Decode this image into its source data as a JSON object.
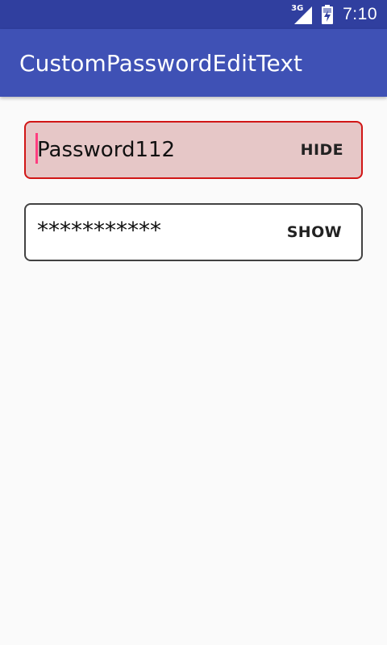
{
  "status_bar": {
    "network_label": "3G",
    "time": "7:10",
    "icons": [
      "signal-icon",
      "battery-icon"
    ]
  },
  "app_bar": {
    "title": "CustomPasswordEditText"
  },
  "fields": [
    {
      "value": "Password112",
      "toggle_label": "HIDE",
      "state": "error",
      "focused": true
    },
    {
      "value": "***********",
      "toggle_label": "SHOW",
      "state": "normal",
      "focused": false
    }
  ],
  "colors": {
    "status_bar": "#303f9f",
    "app_bar": "#3f51b5",
    "background": "#fafafa",
    "error_border": "#d11616",
    "error_fill": "#e6c7c7",
    "normal_border": "#424242",
    "cursor": "#ff3d7f"
  }
}
